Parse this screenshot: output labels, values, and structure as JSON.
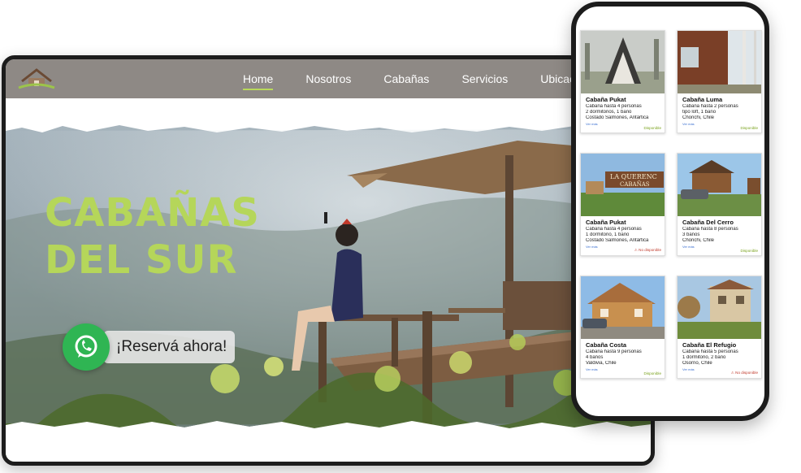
{
  "nav": {
    "items": [
      {
        "label": "Home",
        "active": true
      },
      {
        "label": "Nosotros",
        "active": false
      },
      {
        "label": "Cabañas",
        "active": false
      },
      {
        "label": "Servicios",
        "active": false
      },
      {
        "label": "Ubicación",
        "active": false
      }
    ]
  },
  "hero": {
    "title_line1": "CABAÑAS",
    "title_line2": "DEL SUR",
    "cta_label": "¡Reservá ahora!",
    "cta_icon": "whatsapp-icon"
  },
  "colors": {
    "accent_green": "#b5d65a",
    "nav_bg": "#8e8985",
    "whatsapp": "#2fb553",
    "available": "#7aa21d",
    "unavailable": "#c0392b"
  },
  "cabins": [
    {
      "title": "Cabaña Pukat",
      "lines": [
        "Cabaña hasta 4 personas",
        "2 dormitorios, 1 baño",
        "Costado Salmones, Antártica"
      ],
      "more": "Ver más",
      "status": "Disponible",
      "available": true
    },
    {
      "title": "Cabaña Luma",
      "lines": [
        "Cabaña hasta 2 personas",
        "tipo loft, 1 baño",
        "Chonchi, Chile"
      ],
      "more": "Ver más",
      "status": "Disponible",
      "available": true
    },
    {
      "title": "Cabaña Pukat",
      "lines": [
        "Cabaña hasta 4 personas",
        "1 dormitorio, 1 baño",
        "Costado Salmones, Antártica"
      ],
      "more": "Ver más",
      "status": "No disponible",
      "available": false
    },
    {
      "title": "Cabaña Del Cerro",
      "lines": [
        "Cabaña hasta 8 personas",
        "3 baños",
        "Chonchi, Chile"
      ],
      "more": "Ver más",
      "status": "Disponible",
      "available": true
    },
    {
      "title": "Cabaña Costa",
      "lines": [
        "Cabaña hasta 9 personas",
        "4 baños",
        "Valdivia, Chile"
      ],
      "more": "Ver más",
      "status": "Disponible",
      "available": true
    },
    {
      "title": "Cabaña El Refugio",
      "lines": [
        "Cabaña hasta 5 personas",
        "1 dormitorio, 2 baño",
        "Osorno, Chile"
      ],
      "more": "Ver más",
      "status": "No disponible",
      "available": false
    }
  ],
  "cabin_signs": {
    "sign3": "LA QUERENC",
    "sign3b": "CABAÑAS"
  }
}
